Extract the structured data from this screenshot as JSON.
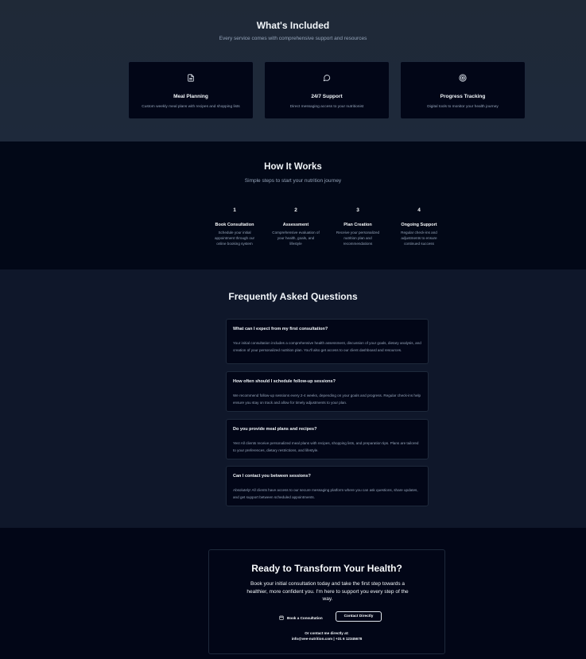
{
  "included": {
    "title": "What's Included",
    "subtitle": "Every service comes with comprehensive support and resources",
    "cards": [
      {
        "icon": "document-icon",
        "title": "Meal Planning",
        "desc": "Custom weekly meal plans with recipes and shopping lists"
      },
      {
        "icon": "chat-bubble-icon",
        "title": "24/7 Support",
        "desc": "Direct messaging access to your nutritionist"
      },
      {
        "icon": "target-icon",
        "title": "Progress Tracking",
        "desc": "Digital tools to monitor your health journey"
      }
    ]
  },
  "how": {
    "title": "How It Works",
    "subtitle": "Simple steps to start your nutrition journey",
    "steps": [
      {
        "num": "1",
        "title": "Book Consultation",
        "desc": "Schedule your initial appointment through our online booking system"
      },
      {
        "num": "2",
        "title": "Assessment",
        "desc": "Comprehensive evaluation of your health, goals, and lifestyle"
      },
      {
        "num": "3",
        "title": "Plan Creation",
        "desc": "Receive your personalized nutrition plan and recommendations"
      },
      {
        "num": "4",
        "title": "Ongoing Support",
        "desc": "Regular check-ins and adjustments to ensure continued success"
      }
    ]
  },
  "faq": {
    "title": "Frequently Asked Questions",
    "items": [
      {
        "q": "What can I expect from my first consultation?",
        "a": "Your initial consultation includes a comprehensive health assessment, discussion of your goals, dietary analysis, and creation of your personalized nutrition plan. You'll also get access to our client dashboard and resources."
      },
      {
        "q": "How often should I schedule follow-up sessions?",
        "a": "We recommend follow-up sessions every 2-4 weeks, depending on your goals and progress. Regular check-ins help ensure you stay on track and allow for timely adjustments to your plan."
      },
      {
        "q": "Do you provide meal plans and recipes?",
        "a": "Yes! All clients receive personalized meal plans with recipes, shopping lists, and preparation tips. Plans are tailored to your preferences, dietary restrictions, and lifestyle."
      },
      {
        "q": "Can I contact you between sessions?",
        "a": "Absolutely! All clients have access to our secure messaging platform where you can ask questions, share updates, and get support between scheduled appointments."
      }
    ]
  },
  "cta": {
    "title": "Ready to Transform Your Health?",
    "text": "Book your initial consultation today and take the first step towards a healthier, more confident you. I'm here to support you every step of the way.",
    "book_label": "Book a Consultation",
    "contact_label": "Contact Directly",
    "or_text": "Or contact me directly at:",
    "contact_info": "info@vee-nutrition.com | +31 6 12345678"
  }
}
